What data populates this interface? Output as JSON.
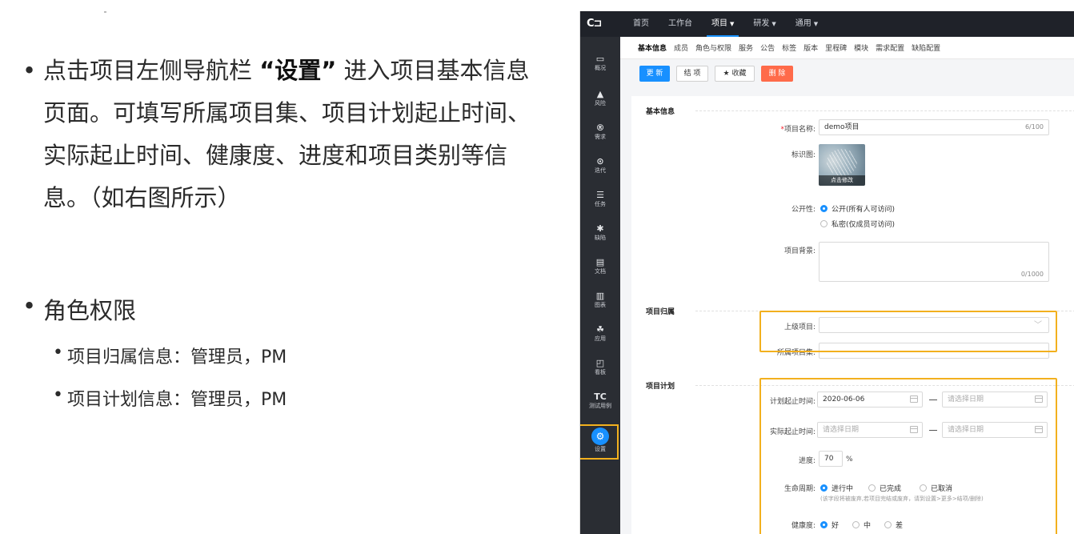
{
  "slide": {
    "bullet1_prefix": "点击项目左侧导航栏 ",
    "bullet1_bold": "“设置”",
    "bullet1_suffix": " 进入项目基本信息页面。可填写所属项目集、项目计划起止时间、实际起止时间、健康度、进度和项目类别等信息。（如右图所示）",
    "bullet2": "角色权限",
    "sub1": "项目归属信息：管理员，PM",
    "sub2": "项目计划信息：管理员，PM",
    "bullet_char": "•"
  },
  "app": {
    "logo": "C⊐",
    "topnav": [
      {
        "label": "首页"
      },
      {
        "label": "工作台"
      },
      {
        "label": "项目",
        "caret": "▼"
      },
      {
        "label": "研发",
        "caret": "▼"
      },
      {
        "label": "通用",
        "caret": "▼"
      }
    ],
    "sidebar": [
      {
        "icon": "▭",
        "label": "概况"
      },
      {
        "icon": "▲",
        "label": "风险"
      },
      {
        "icon": "®",
        "label": "需求"
      },
      {
        "icon": "⊙",
        "label": "迭代"
      },
      {
        "icon": "☰",
        "label": "任务"
      },
      {
        "icon": "✱",
        "label": "缺陷"
      },
      {
        "icon": "▤",
        "label": "文档"
      },
      {
        "icon": "▥",
        "label": "图表"
      },
      {
        "icon": "☘",
        "label": "应用"
      },
      {
        "icon": "◰",
        "label": "看板"
      },
      {
        "icon": "TC",
        "label": "测试用例"
      },
      {
        "icon": "⚙",
        "label": "设置"
      }
    ],
    "subnav": [
      "基本信息",
      "成员",
      "角色与权限",
      "服务",
      "公告",
      "标签",
      "版本",
      "里程碑",
      "模块",
      "需求配置",
      "缺陷配置"
    ],
    "toolbar": {
      "update": "更 新",
      "close": "结 项",
      "favorite": "★ 收藏",
      "delete": "删 除"
    },
    "form": {
      "section_basic": "基本信息",
      "name_label": "项目名称:",
      "name_value": "demo项目",
      "name_count": "6/100",
      "logo_label": "标识图:",
      "logo_caption": "点击修改",
      "visibility_label": "公开性:",
      "visibility_public": "公开(所有人可访问)",
      "visibility_private": "私密(仅成员可访问)",
      "background_label": "项目背景:",
      "background_count": "0/1000",
      "section_belong": "项目归属",
      "parent_label": "上级项目:",
      "parent_chevron": "﹀",
      "set_label": "所属项目集:",
      "section_plan": "项目计划",
      "plan_time_label": "计划起止时间:",
      "plan_start": "2020-06-06",
      "date_placeholder": "请选择日期",
      "actual_time_label": "实际起止时间:",
      "progress_label": "进度:",
      "progress_value": "70",
      "progress_unit": "%",
      "lifecycle_label": "生命周期:",
      "lifecycle_options": [
        "进行中",
        "已完成",
        "已取消"
      ],
      "lifecycle_note": "(该字段将被废弃,若项目完结或废弃，请到设置>更多>结项/删除)",
      "health_label": "健康度:",
      "health_options": [
        "好",
        "中",
        "差"
      ]
    },
    "colors": {
      "accent": "#1890ff",
      "highlight": "#f2b01e",
      "danger": "#ff6b4a",
      "topbar": "#1f2229",
      "sidebar": "#2a2d33"
    }
  }
}
